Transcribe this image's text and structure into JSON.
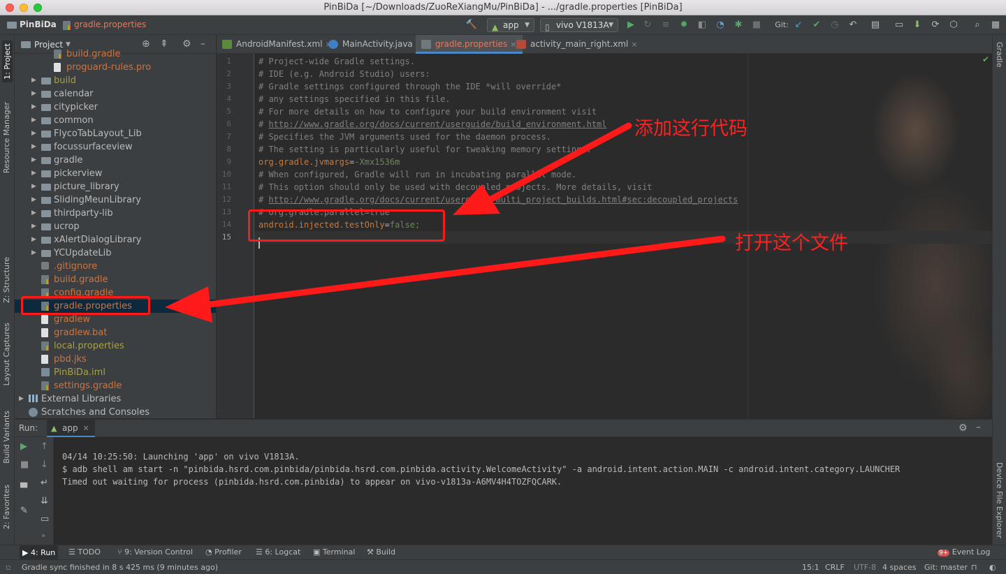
{
  "window": {
    "title": "PinBiDa [~/Downloads/ZuoReXiangMu/PinBiDa] - .../gradle.properties [PinBiDa]"
  },
  "navbar": {
    "project": "PinBiDa",
    "file": "gradle.properties",
    "run_config": "app",
    "device": "vivo V1813A",
    "git_label": "Git:"
  },
  "left_strip": {
    "project": "1: Project",
    "resource_manager": "Resource Manager",
    "structure": "Z: Structure",
    "layout_captures": "Layout Captures",
    "build_variants": "Build Variants",
    "favorites": "2: Favorites"
  },
  "right_strip": {
    "gradle": "Gradle",
    "device_explorer": "Device File Explorer"
  },
  "project_panel": {
    "title": "Project",
    "items": [
      {
        "name": "build.gradle",
        "color": "orange",
        "indent": 2,
        "type": "gradle",
        "expand": ""
      },
      {
        "name": "proguard-rules.pro",
        "color": "orange",
        "indent": 2,
        "type": "file",
        "expand": ""
      },
      {
        "name": "build",
        "color": "olive",
        "indent": 1,
        "type": "folder",
        "expand": "▶"
      },
      {
        "name": "calendar",
        "color": "norm",
        "indent": 1,
        "type": "folder",
        "expand": "▶"
      },
      {
        "name": "citypicker",
        "color": "norm",
        "indent": 1,
        "type": "folder",
        "expand": "▶"
      },
      {
        "name": "common",
        "color": "norm",
        "indent": 1,
        "type": "folder",
        "expand": "▶"
      },
      {
        "name": "FlycoTabLayout_Lib",
        "color": "norm",
        "indent": 1,
        "type": "folder",
        "expand": "▶"
      },
      {
        "name": "focussurfaceview",
        "color": "norm",
        "indent": 1,
        "type": "folder",
        "expand": "▶"
      },
      {
        "name": "gradle",
        "color": "norm",
        "indent": 1,
        "type": "folder",
        "expand": "▶"
      },
      {
        "name": "pickerview",
        "color": "norm",
        "indent": 1,
        "type": "folder",
        "expand": "▶"
      },
      {
        "name": "picture_library",
        "color": "norm",
        "indent": 1,
        "type": "folder",
        "expand": "▶"
      },
      {
        "name": "SlidingMeunLibrary",
        "color": "norm",
        "indent": 1,
        "type": "folder",
        "expand": "▶"
      },
      {
        "name": "thirdparty-lib",
        "color": "norm",
        "indent": 1,
        "type": "folder",
        "expand": "▶"
      },
      {
        "name": "ucrop",
        "color": "norm",
        "indent": 1,
        "type": "folder",
        "expand": "▶"
      },
      {
        "name": "xAlertDialogLibrary",
        "color": "norm",
        "indent": 1,
        "type": "folder",
        "expand": "▶"
      },
      {
        "name": "YCUpdateLib",
        "color": "norm",
        "indent": 1,
        "type": "folder",
        "expand": "▶"
      },
      {
        "name": ".gitignore",
        "color": "orange",
        "indent": 1,
        "type": "git",
        "expand": ""
      },
      {
        "name": "build.gradle",
        "color": "orange",
        "indent": 1,
        "type": "gradle",
        "expand": ""
      },
      {
        "name": "config.gradle",
        "color": "orange",
        "indent": 1,
        "type": "gradle",
        "expand": ""
      },
      {
        "name": "gradle.properties",
        "color": "orange",
        "indent": 1,
        "type": "gradle",
        "expand": "",
        "selected": true
      },
      {
        "name": "gradlew",
        "color": "orange",
        "indent": 1,
        "type": "file",
        "expand": ""
      },
      {
        "name": "gradlew.bat",
        "color": "orange",
        "indent": 1,
        "type": "file",
        "expand": ""
      },
      {
        "name": "local.properties",
        "color": "olive",
        "indent": 1,
        "type": "gradle",
        "expand": ""
      },
      {
        "name": "pbd.jks",
        "color": "orange",
        "indent": 1,
        "type": "file",
        "expand": ""
      },
      {
        "name": "PinBiDa.iml",
        "color": "olive",
        "indent": 1,
        "type": "iml",
        "expand": ""
      },
      {
        "name": "settings.gradle",
        "color": "orange",
        "indent": 1,
        "type": "gradle",
        "expand": ""
      },
      {
        "name": "External Libraries",
        "color": "norm",
        "indent": 0,
        "type": "lib",
        "expand": "▶"
      },
      {
        "name": "Scratches and Consoles",
        "color": "norm",
        "indent": 0,
        "type": "scratch",
        "expand": ""
      }
    ]
  },
  "editor_tabs": [
    {
      "label": "AndroidManifest.xml",
      "active": false
    },
    {
      "label": "MainActivity.java",
      "active": false
    },
    {
      "label": "gradle.properties",
      "active": true
    },
    {
      "label": "activity_main_right.xml",
      "active": false
    }
  ],
  "code_lines": [
    {
      "n": "1",
      "parts": [
        {
          "t": "# Project-wide Gradle settings.",
          "c": "cm"
        }
      ]
    },
    {
      "n": "2",
      "parts": [
        {
          "t": "# IDE (e.g. Android Studio) users:",
          "c": "cm"
        }
      ]
    },
    {
      "n": "3",
      "parts": [
        {
          "t": "# Gradle settings configured through the IDE *will override*",
          "c": "cm"
        }
      ]
    },
    {
      "n": "4",
      "parts": [
        {
          "t": "# any settings specified in this file.",
          "c": "cm"
        }
      ]
    },
    {
      "n": "5",
      "parts": [
        {
          "t": "# For more details on how to configure your build environment visit",
          "c": "cm"
        }
      ]
    },
    {
      "n": "6",
      "parts": [
        {
          "t": "# ",
          "c": "cm"
        },
        {
          "t": "http://www.gradle.org/docs/current/userguide/build_environment.html",
          "c": "lk"
        }
      ]
    },
    {
      "n": "7",
      "parts": [
        {
          "t": "# Specifies the JVM arguments used for the daemon process.",
          "c": "cm"
        }
      ]
    },
    {
      "n": "8",
      "parts": [
        {
          "t": "# The setting is particularly useful for tweaking memory settings.",
          "c": "cm"
        }
      ]
    },
    {
      "n": "9",
      "parts": [
        {
          "t": "org.gradle.jvmargs",
          "c": "key"
        },
        {
          "t": "=",
          "c": "eq"
        },
        {
          "t": "-Xmx1536m",
          "c": "val"
        }
      ]
    },
    {
      "n": "10",
      "parts": [
        {
          "t": "# When configured, Gradle will run in incubating parallel mode.",
          "c": "cm"
        }
      ]
    },
    {
      "n": "11",
      "parts": [
        {
          "t": "# This option should only be used with decoupled projects. More details, visit",
          "c": "cm"
        }
      ]
    },
    {
      "n": "12",
      "parts": [
        {
          "t": "# ",
          "c": "cm"
        },
        {
          "t": "http://www.gradle.org/docs/current/userguide/multi_project_builds.html#sec:decoupled_projects",
          "c": "lk"
        }
      ]
    },
    {
      "n": "13",
      "parts": [
        {
          "t": "# org.gradle.parallel=true",
          "c": "cm"
        }
      ]
    },
    {
      "n": "14",
      "parts": [
        {
          "t": "android.injected.testOnly",
          "c": "key"
        },
        {
          "t": "=",
          "c": "eq"
        },
        {
          "t": "false;",
          "c": "val"
        }
      ]
    },
    {
      "n": "15",
      "parts": [
        {
          "t": "",
          "c": "cm"
        }
      ]
    }
  ],
  "run_panel": {
    "label": "Run:",
    "tab": "app",
    "lines": [
      "04/14 10:25:50: Launching 'app' on vivo V1813A.",
      "$ adb shell am start -n \"pinbida.hsrd.com.pinbida/pinbida.hsrd.com.pinbida.activity.WelcomeActivity\" -a android.intent.action.MAIN -c android.intent.category.LAUNCHER",
      "Timed out waiting for process (pinbida.hsrd.com.pinbida) to appear on vivo-v1813a-A6MV4H4TOZFQCARK."
    ]
  },
  "bottom_tabs": {
    "run": "4: Run",
    "todo": "TODO",
    "vcs": "9: Version Control",
    "profiler": "Profiler",
    "logcat": "6: Logcat",
    "terminal": "Terminal",
    "build": "Build",
    "event_log": "Event Log",
    "event_badge": "9+"
  },
  "status": {
    "message": "Gradle sync finished in 8 s 425 ms (9 minutes ago)",
    "position": "15:1",
    "line_sep": "CRLF",
    "encoding": "UTF-8",
    "indent": "4 spaces",
    "branch": "Git: master"
  },
  "annotations": {
    "add_line": "添加这行代码",
    "open_file": "打开这个文件",
    "color": "#ff1a1a"
  }
}
